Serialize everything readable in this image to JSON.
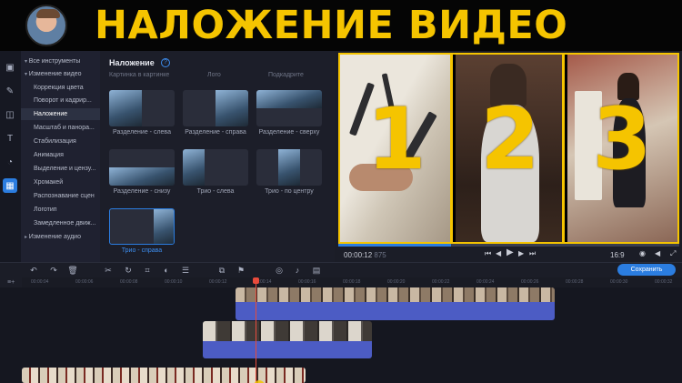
{
  "banner": {
    "title": "НАЛОЖЕНИЕ ВИДЕО"
  },
  "toolbar": {
    "icons": [
      "import-icon",
      "magic-icon",
      "transition-icon",
      "text-icon",
      "clock-icon",
      "overlay-icon"
    ]
  },
  "sidebar": {
    "items": [
      {
        "label": "Все инструменты"
      },
      {
        "label": "Изменение видео"
      },
      {
        "label": "Коррекция цвета"
      },
      {
        "label": "Поворот и кадрир..."
      },
      {
        "label": "Наложение"
      },
      {
        "label": "Масштаб и панора..."
      },
      {
        "label": "Стабилизация"
      },
      {
        "label": "Анимация"
      },
      {
        "label": "Выделение и цензу..."
      },
      {
        "label": "Хромакей"
      },
      {
        "label": "Распознавание сцен"
      },
      {
        "label": "Логотип"
      },
      {
        "label": "Замедленное движ..."
      },
      {
        "label": "Изменение аудио"
      }
    ]
  },
  "panel": {
    "title": "Наложение",
    "cut_labels": [
      "Картинка в картинке",
      "Лого",
      "Подкадрите"
    ],
    "tiles": [
      {
        "label": "Разделение - слева"
      },
      {
        "label": "Разделение - справа"
      },
      {
        "label": "Разделение - сверху"
      },
      {
        "label": "Разделение - снизу"
      },
      {
        "label": "Трио - слева"
      },
      {
        "label": "Трио - по центру"
      },
      {
        "label": "Трио - справа"
      }
    ]
  },
  "preview": {
    "numbers": [
      "1",
      "2",
      "3"
    ],
    "time_current": "00:00:12",
    "time_fraction": "875",
    "aspect": "16:9",
    "progress": 0.33
  },
  "timeline": {
    "save_label": "Сохранить",
    "ticks": [
      "00:00:04",
      "00:00:06",
      "00:00:08",
      "00:00:10",
      "00:00:12",
      "00:00:14",
      "00:00:16",
      "00:00:18",
      "00:00:20",
      "00:00:22",
      "00:00:24",
      "00:00:26",
      "00:00:28",
      "00:00:30",
      "00:00:32"
    ]
  }
}
